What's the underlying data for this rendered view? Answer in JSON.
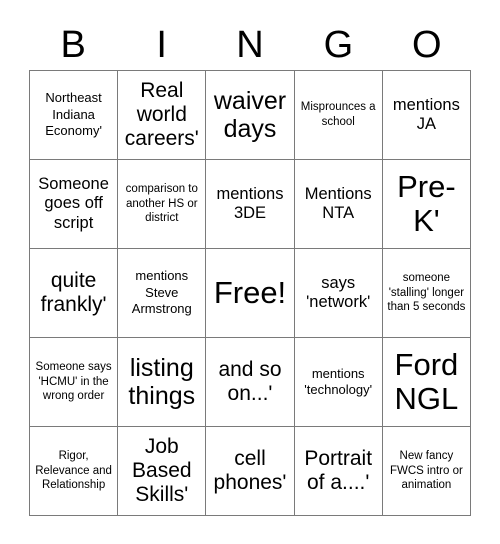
{
  "card": {
    "title": "BINGO",
    "header_letters": [
      "B",
      "I",
      "N",
      "G",
      "O"
    ],
    "rows": [
      [
        {
          "text": "Northeast Indiana Economy'",
          "size": "sm"
        },
        {
          "text": "Real world careers'",
          "size": "lg"
        },
        {
          "text": "waiver days",
          "size": "xl"
        },
        {
          "text": "Misprounces a school",
          "size": "xs"
        },
        {
          "text": "mentions JA",
          "size": "md"
        }
      ],
      [
        {
          "text": "Someone goes off script",
          "size": "md"
        },
        {
          "text": "comparison to another HS or district",
          "size": "xs"
        },
        {
          "text": "mentions 3DE",
          "size": "md"
        },
        {
          "text": "Mentions NTA",
          "size": "md"
        },
        {
          "text": "Pre-K'",
          "size": "xxl"
        }
      ],
      [
        {
          "text": "quite frankly'",
          "size": "lg"
        },
        {
          "text": "mentions Steve Armstrong",
          "size": "sm"
        },
        {
          "text": "Free!",
          "size": "xxl"
        },
        {
          "text": "says 'network'",
          "size": "md"
        },
        {
          "text": "someone 'stalling' longer than 5 seconds",
          "size": "xs"
        }
      ],
      [
        {
          "text": "Someone says 'HCMU' in the wrong order",
          "size": "xs"
        },
        {
          "text": "listing things",
          "size": "xl"
        },
        {
          "text": "and so on...'",
          "size": "lg"
        },
        {
          "text": "mentions 'technology'",
          "size": "sm"
        },
        {
          "text": "Ford NGL",
          "size": "xxl"
        }
      ],
      [
        {
          "text": "Rigor, Relevance and Relationship",
          "size": "xs"
        },
        {
          "text": "Job Based Skills'",
          "size": "lg"
        },
        {
          "text": "cell phones'",
          "size": "lg"
        },
        {
          "text": "Portrait of a....'",
          "size": "lg"
        },
        {
          "text": "New fancy FWCS intro or animation",
          "size": "xs"
        }
      ]
    ],
    "colors": {
      "background": "#ffffff",
      "text": "#000000",
      "grid_line": "#7a7a7a"
    }
  }
}
